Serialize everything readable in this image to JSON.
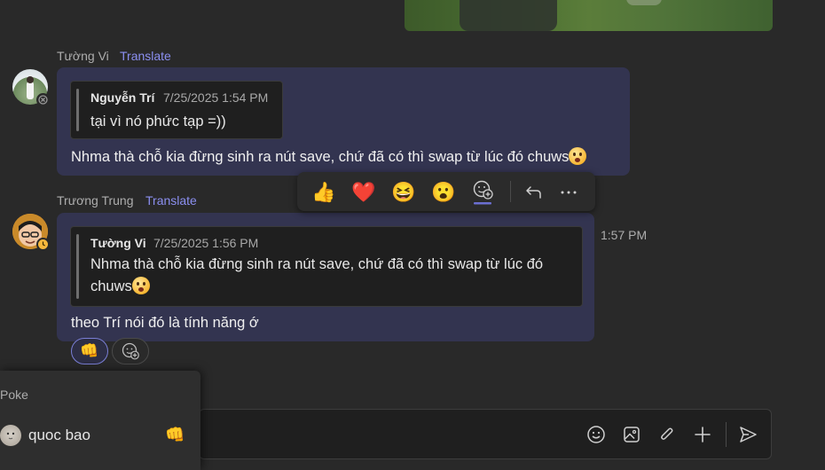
{
  "messages": [
    {
      "sender": "Tường Vi",
      "translate": "Translate",
      "quote": {
        "author": "Nguyễn Trí",
        "time": "7/25/2025 1:54 PM",
        "text": "tại vì nó phức tạp =))"
      },
      "text": "Nhma thà chỗ kia đừng sinh ra nút save, chứ đã có thì swap từ lúc đó chuws"
    },
    {
      "sender": "Trương Trung",
      "translate": "Translate",
      "timestamp": "1:57 PM",
      "quote": {
        "author": "Tường Vi",
        "time": "7/25/2025 1:56 PM",
        "text_line1": "Nhma thà chỗ kia đừng sinh ra nút save, chứ đã có thì swap từ lúc đó",
        "text_line2": "chuws"
      },
      "text": "theo Trí nói đó là tính năng ớ",
      "reaction": "👊"
    }
  ],
  "reaction_bar": {
    "emojis": [
      "👍",
      "❤️",
      "😆",
      "😮"
    ],
    "icons": [
      "add-reaction-icon",
      "reply-icon",
      "more-options-icon"
    ]
  },
  "poke_panel": {
    "title": "Poke",
    "user": "quoc bao",
    "reaction": "👊"
  },
  "compose": {
    "icons": [
      "emoji-icon",
      "image-icon",
      "attach-icon",
      "plus-icon",
      "send-icon"
    ]
  },
  "colors": {
    "bubble": "#333450",
    "accent": "#8b8ff0",
    "background": "#292929"
  }
}
